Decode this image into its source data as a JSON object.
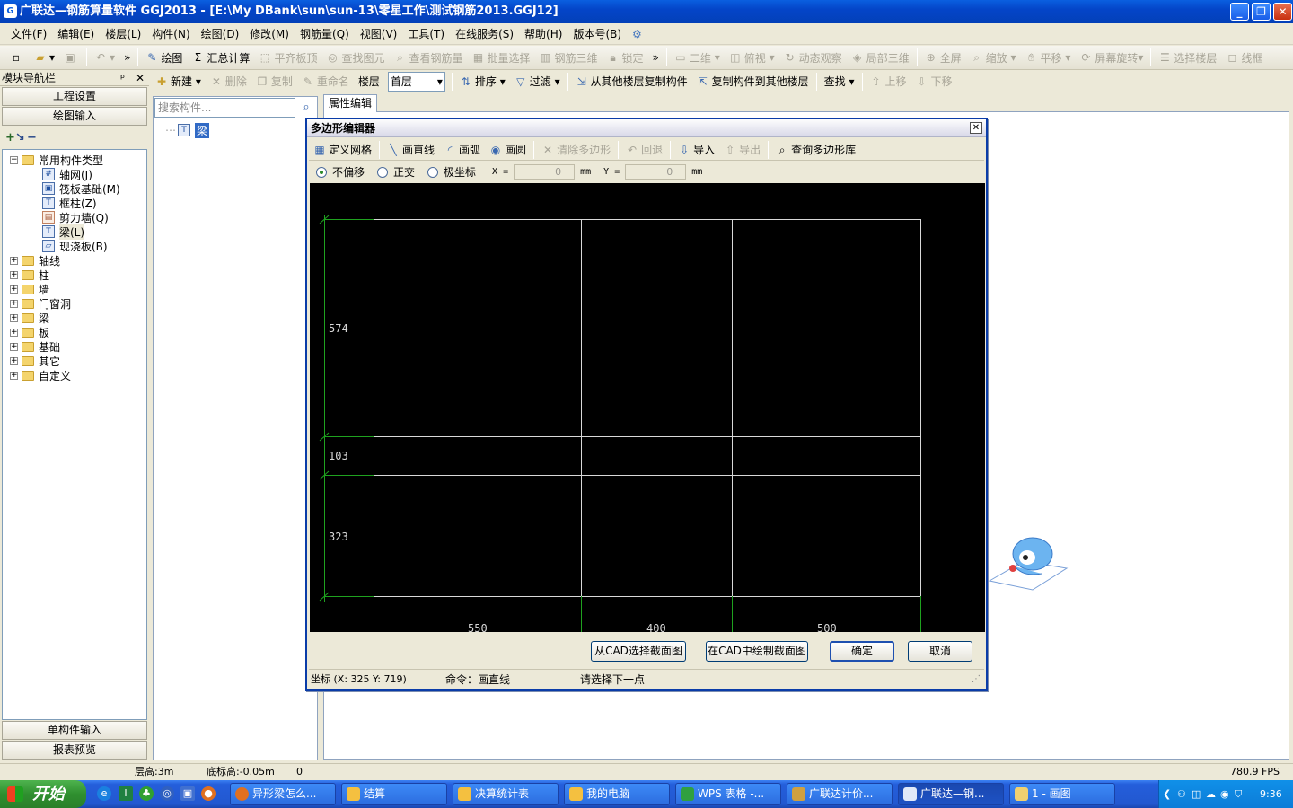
{
  "window": {
    "title": "广联达—钢筋算量软件 GGJ2013 - [E:\\My DBank\\sun\\sun-13\\零星工作\\测试钢筋2013.GGJ12]",
    "minimize": "_",
    "restore": "❐",
    "close": "✕"
  },
  "menu": [
    "文件(F)",
    "编辑(E)",
    "楼层(L)",
    "构件(N)",
    "绘图(D)",
    "修改(M)",
    "钢筋量(Q)",
    "视图(V)",
    "工具(T)",
    "在线服务(S)",
    "帮助(H)",
    "版本号(B)"
  ],
  "toolbar1": {
    "draw": "绘图",
    "summary": "汇总计算",
    "flush_top": "平齐板顶",
    "find_element": "查找图元",
    "view_rebar": "查看钢筋量",
    "batch_select": "批量选择",
    "rebar_3d": "钢筋三维",
    "lock": "锁定",
    "view_mode": "二维",
    "top_view": "俯视",
    "dynamic_view": "动态观察",
    "local_3d": "局部三维",
    "fullscreen": "全屏",
    "zoom": "缩放",
    "pan": "平移",
    "screen_rotate": "屏幕旋转",
    "select_floor": "选择楼层",
    "wireframe": "线框"
  },
  "nav": {
    "header": "模块导航栏",
    "pin": "ᵖ",
    "close": "✕",
    "project_settings": "工程设置",
    "drawing_input": "绘图输入",
    "single_input": "单构件输入",
    "report_preview": "报表预览",
    "tree": {
      "common_types": "常用构件类型",
      "common_items": [
        "轴网(J)",
        "筏板基础(M)",
        "框柱(Z)",
        "剪力墙(Q)",
        "梁(L)",
        "现浇板(B)"
      ],
      "groups": [
        "轴线",
        "柱",
        "墙",
        "门窗洞",
        "梁",
        "板",
        "基础",
        "其它",
        "自定义"
      ]
    }
  },
  "compbar": {
    "new": "新建",
    "delete": "删除",
    "copy": "复制",
    "rename": "重命名",
    "floor_label": "楼层",
    "floor_value": "首层",
    "sort": "排序",
    "filter": "过滤",
    "copy_from_floor": "从其他楼层复制构件",
    "copy_to_floor": "复制构件到其他楼层",
    "find": "查找",
    "move_up": "上移",
    "move_down": "下移"
  },
  "list": {
    "search_placeholder": "搜索构件...",
    "item": "梁"
  },
  "prop_tab": "属性编辑",
  "dialog": {
    "title": "多边形编辑器",
    "tools": {
      "define_grid": "定义网格",
      "draw_line": "画直线",
      "draw_arc": "画弧",
      "draw_circle": "画圆",
      "clear_polygon": "清除多边形",
      "undo": "回退",
      "import": "导入",
      "export": "导出",
      "query_lib": "查询多边形库"
    },
    "options": {
      "no_offset": "不偏移",
      "ortho": "正交",
      "polar": "极坐标",
      "x_label": "X =",
      "x_value": "0",
      "x_unit": "mm",
      "y_label": "Y =",
      "y_value": "0",
      "y_unit": "mm"
    },
    "grid": {
      "row_dims": [
        "574",
        "103",
        "323"
      ],
      "col_dims": [
        "550",
        "400",
        "500"
      ]
    },
    "buttons": {
      "cad_select": "从CAD选择截面图",
      "cad_draw": "在CAD中绘制截面图",
      "ok": "确定",
      "cancel": "取消"
    },
    "status": {
      "coords": "坐标 (X: 325 Y: 719)",
      "command": "命令：画直线",
      "prompt": "请选择下一点"
    }
  },
  "statusbar": {
    "floor_height": "层高:3m",
    "base_elev": "底标高:-0.05m",
    "zero": "0",
    "fps": "780.9 FPS"
  },
  "taskbar": {
    "start": "开始",
    "tasks": [
      "异形梁怎么...",
      "结算",
      "决算统计表",
      "我的电脑",
      "WPS 表格 -...",
      "广联达计价...",
      "广联达—钢...",
      "1 - 画图"
    ],
    "clock": "9:36"
  }
}
